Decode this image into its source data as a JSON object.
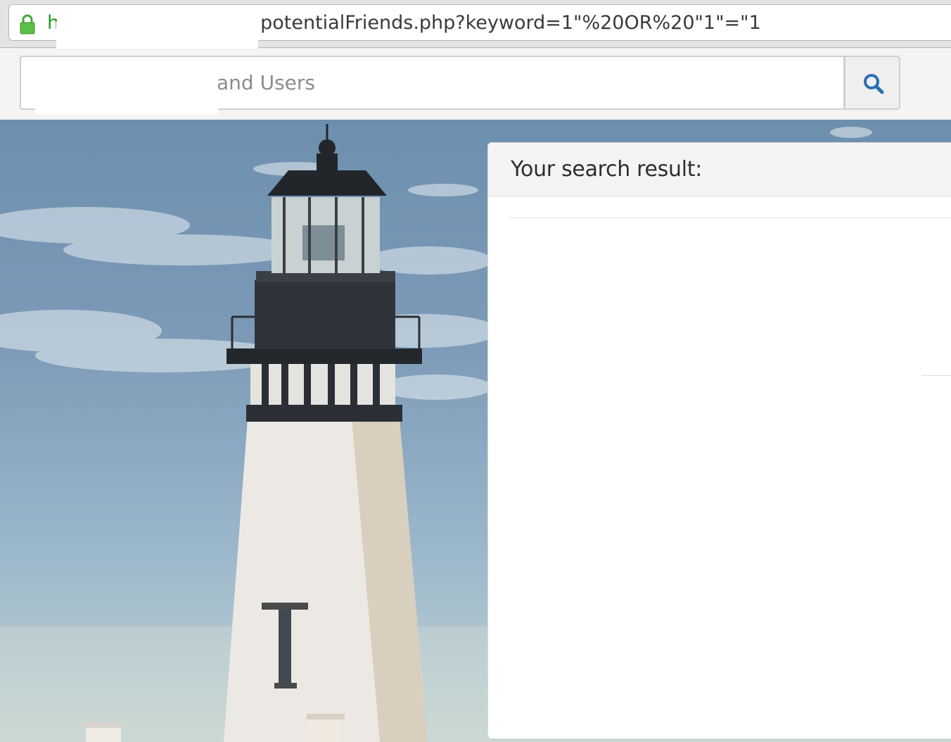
{
  "browser": {
    "url_scheme": "h",
    "url_path": "potentialFriends.php?keyword=1\"%20OR%20\"1\"=\"1",
    "lock_icon": "lock-icon",
    "accent_green": "#1f9a1f"
  },
  "search": {
    "placeholder_visible": "and Users",
    "button_icon": "search-icon",
    "icon_color": "#2a6db5"
  },
  "results": {
    "title": "Your search result:"
  }
}
